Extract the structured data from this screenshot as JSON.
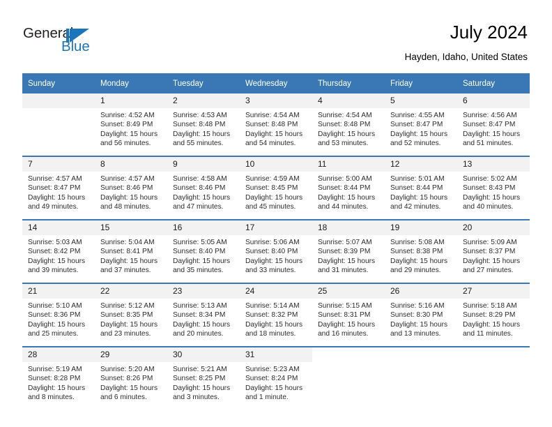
{
  "brand": {
    "name_part1": "General",
    "name_part2": "Blue",
    "accent_color": "#1b75bb"
  },
  "header": {
    "title": "July 2024",
    "location": "Hayden, Idaho, United States"
  },
  "theme": {
    "header_bg": "#3a78b5",
    "header_text": "#ffffff",
    "daynum_band_bg": "#f2f2f2",
    "week_separator": "#3a78b5"
  },
  "weekdays": [
    "Sunday",
    "Monday",
    "Tuesday",
    "Wednesday",
    "Thursday",
    "Friday",
    "Saturday"
  ],
  "labels": {
    "sunrise": "Sunrise:",
    "sunset": "Sunset:",
    "daylight": "Daylight:"
  },
  "weeks": [
    [
      {
        "day": "",
        "sunrise": "",
        "sunset": "",
        "daylight_line1": "",
        "daylight_line2": ""
      },
      {
        "day": "1",
        "sunrise": "Sunrise: 4:52 AM",
        "sunset": "Sunset: 8:49 PM",
        "daylight_line1": "Daylight: 15 hours",
        "daylight_line2": "and 56 minutes."
      },
      {
        "day": "2",
        "sunrise": "Sunrise: 4:53 AM",
        "sunset": "Sunset: 8:48 PM",
        "daylight_line1": "Daylight: 15 hours",
        "daylight_line2": "and 55 minutes."
      },
      {
        "day": "3",
        "sunrise": "Sunrise: 4:54 AM",
        "sunset": "Sunset: 8:48 PM",
        "daylight_line1": "Daylight: 15 hours",
        "daylight_line2": "and 54 minutes."
      },
      {
        "day": "4",
        "sunrise": "Sunrise: 4:54 AM",
        "sunset": "Sunset: 8:48 PM",
        "daylight_line1": "Daylight: 15 hours",
        "daylight_line2": "and 53 minutes."
      },
      {
        "day": "5",
        "sunrise": "Sunrise: 4:55 AM",
        "sunset": "Sunset: 8:47 PM",
        "daylight_line1": "Daylight: 15 hours",
        "daylight_line2": "and 52 minutes."
      },
      {
        "day": "6",
        "sunrise": "Sunrise: 4:56 AM",
        "sunset": "Sunset: 8:47 PM",
        "daylight_line1": "Daylight: 15 hours",
        "daylight_line2": "and 51 minutes."
      }
    ],
    [
      {
        "day": "7",
        "sunrise": "Sunrise: 4:57 AM",
        "sunset": "Sunset: 8:47 PM",
        "daylight_line1": "Daylight: 15 hours",
        "daylight_line2": "and 49 minutes."
      },
      {
        "day": "8",
        "sunrise": "Sunrise: 4:57 AM",
        "sunset": "Sunset: 8:46 PM",
        "daylight_line1": "Daylight: 15 hours",
        "daylight_line2": "and 48 minutes."
      },
      {
        "day": "9",
        "sunrise": "Sunrise: 4:58 AM",
        "sunset": "Sunset: 8:46 PM",
        "daylight_line1": "Daylight: 15 hours",
        "daylight_line2": "and 47 minutes."
      },
      {
        "day": "10",
        "sunrise": "Sunrise: 4:59 AM",
        "sunset": "Sunset: 8:45 PM",
        "daylight_line1": "Daylight: 15 hours",
        "daylight_line2": "and 45 minutes."
      },
      {
        "day": "11",
        "sunrise": "Sunrise: 5:00 AM",
        "sunset": "Sunset: 8:44 PM",
        "daylight_line1": "Daylight: 15 hours",
        "daylight_line2": "and 44 minutes."
      },
      {
        "day": "12",
        "sunrise": "Sunrise: 5:01 AM",
        "sunset": "Sunset: 8:44 PM",
        "daylight_line1": "Daylight: 15 hours",
        "daylight_line2": "and 42 minutes."
      },
      {
        "day": "13",
        "sunrise": "Sunrise: 5:02 AM",
        "sunset": "Sunset: 8:43 PM",
        "daylight_line1": "Daylight: 15 hours",
        "daylight_line2": "and 40 minutes."
      }
    ],
    [
      {
        "day": "14",
        "sunrise": "Sunrise: 5:03 AM",
        "sunset": "Sunset: 8:42 PM",
        "daylight_line1": "Daylight: 15 hours",
        "daylight_line2": "and 39 minutes."
      },
      {
        "day": "15",
        "sunrise": "Sunrise: 5:04 AM",
        "sunset": "Sunset: 8:41 PM",
        "daylight_line1": "Daylight: 15 hours",
        "daylight_line2": "and 37 minutes."
      },
      {
        "day": "16",
        "sunrise": "Sunrise: 5:05 AM",
        "sunset": "Sunset: 8:40 PM",
        "daylight_line1": "Daylight: 15 hours",
        "daylight_line2": "and 35 minutes."
      },
      {
        "day": "17",
        "sunrise": "Sunrise: 5:06 AM",
        "sunset": "Sunset: 8:40 PM",
        "daylight_line1": "Daylight: 15 hours",
        "daylight_line2": "and 33 minutes."
      },
      {
        "day": "18",
        "sunrise": "Sunrise: 5:07 AM",
        "sunset": "Sunset: 8:39 PM",
        "daylight_line1": "Daylight: 15 hours",
        "daylight_line2": "and 31 minutes."
      },
      {
        "day": "19",
        "sunrise": "Sunrise: 5:08 AM",
        "sunset": "Sunset: 8:38 PM",
        "daylight_line1": "Daylight: 15 hours",
        "daylight_line2": "and 29 minutes."
      },
      {
        "day": "20",
        "sunrise": "Sunrise: 5:09 AM",
        "sunset": "Sunset: 8:37 PM",
        "daylight_line1": "Daylight: 15 hours",
        "daylight_line2": "and 27 minutes."
      }
    ],
    [
      {
        "day": "21",
        "sunrise": "Sunrise: 5:10 AM",
        "sunset": "Sunset: 8:36 PM",
        "daylight_line1": "Daylight: 15 hours",
        "daylight_line2": "and 25 minutes."
      },
      {
        "day": "22",
        "sunrise": "Sunrise: 5:12 AM",
        "sunset": "Sunset: 8:35 PM",
        "daylight_line1": "Daylight: 15 hours",
        "daylight_line2": "and 23 minutes."
      },
      {
        "day": "23",
        "sunrise": "Sunrise: 5:13 AM",
        "sunset": "Sunset: 8:34 PM",
        "daylight_line1": "Daylight: 15 hours",
        "daylight_line2": "and 20 minutes."
      },
      {
        "day": "24",
        "sunrise": "Sunrise: 5:14 AM",
        "sunset": "Sunset: 8:32 PM",
        "daylight_line1": "Daylight: 15 hours",
        "daylight_line2": "and 18 minutes."
      },
      {
        "day": "25",
        "sunrise": "Sunrise: 5:15 AM",
        "sunset": "Sunset: 8:31 PM",
        "daylight_line1": "Daylight: 15 hours",
        "daylight_line2": "and 16 minutes."
      },
      {
        "day": "26",
        "sunrise": "Sunrise: 5:16 AM",
        "sunset": "Sunset: 8:30 PM",
        "daylight_line1": "Daylight: 15 hours",
        "daylight_line2": "and 13 minutes."
      },
      {
        "day": "27",
        "sunrise": "Sunrise: 5:18 AM",
        "sunset": "Sunset: 8:29 PM",
        "daylight_line1": "Daylight: 15 hours",
        "daylight_line2": "and 11 minutes."
      }
    ],
    [
      {
        "day": "28",
        "sunrise": "Sunrise: 5:19 AM",
        "sunset": "Sunset: 8:28 PM",
        "daylight_line1": "Daylight: 15 hours",
        "daylight_line2": "and 8 minutes."
      },
      {
        "day": "29",
        "sunrise": "Sunrise: 5:20 AM",
        "sunset": "Sunset: 8:26 PM",
        "daylight_line1": "Daylight: 15 hours",
        "daylight_line2": "and 6 minutes."
      },
      {
        "day": "30",
        "sunrise": "Sunrise: 5:21 AM",
        "sunset": "Sunset: 8:25 PM",
        "daylight_line1": "Daylight: 15 hours",
        "daylight_line2": "and 3 minutes."
      },
      {
        "day": "31",
        "sunrise": "Sunrise: 5:23 AM",
        "sunset": "Sunset: 8:24 PM",
        "daylight_line1": "Daylight: 15 hours",
        "daylight_line2": "and 1 minute."
      },
      {
        "day": "",
        "sunrise": "",
        "sunset": "",
        "daylight_line1": "",
        "daylight_line2": ""
      },
      {
        "day": "",
        "sunrise": "",
        "sunset": "",
        "daylight_line1": "",
        "daylight_line2": ""
      },
      {
        "day": "",
        "sunrise": "",
        "sunset": "",
        "daylight_line1": "",
        "daylight_line2": ""
      }
    ]
  ]
}
